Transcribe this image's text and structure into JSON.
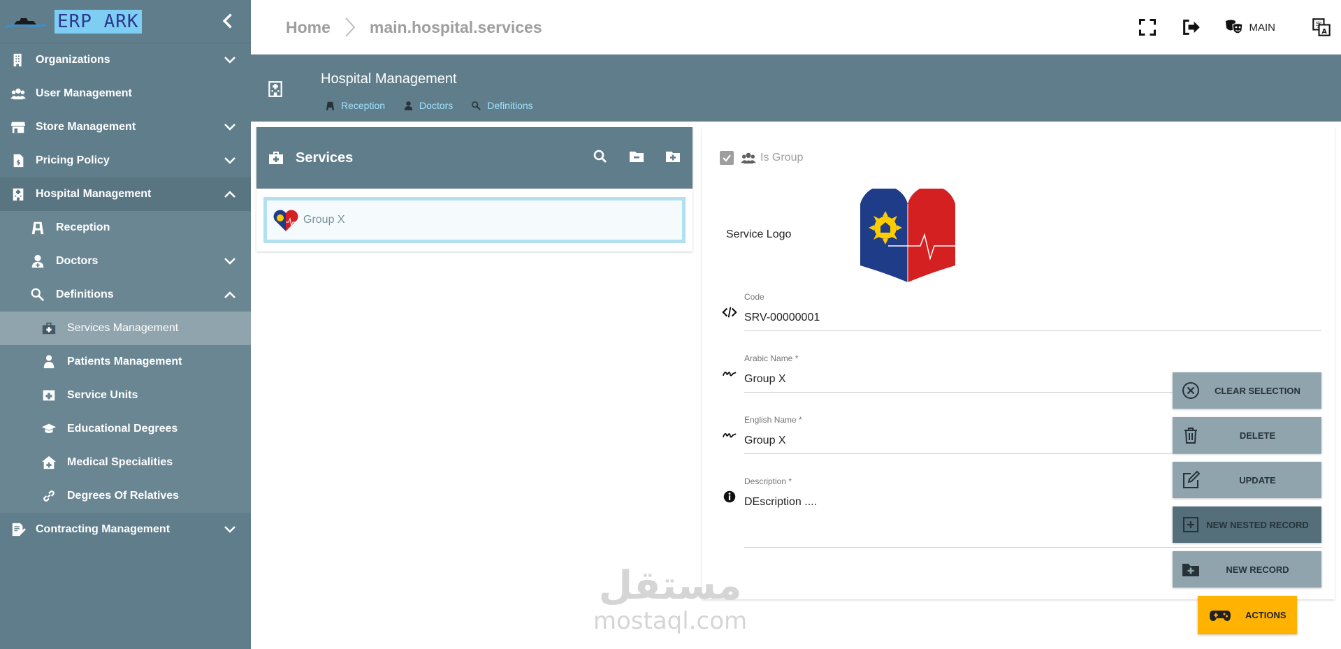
{
  "app": {
    "logo_text": "ERP ARK"
  },
  "sidebar": {
    "items": [
      {
        "label": "Organizations",
        "icon": "building-icon",
        "expand": "down"
      },
      {
        "label": "User Management",
        "icon": "users-icon"
      },
      {
        "label": "Store Management",
        "icon": "store-icon",
        "expand": "down"
      },
      {
        "label": "Pricing Policy",
        "icon": "pricing-icon",
        "expand": "down"
      },
      {
        "label": "Hospital Management",
        "icon": "hospital-icon",
        "expand": "up"
      },
      {
        "label": "Reception",
        "icon": "reception-icon"
      },
      {
        "label": "Doctors",
        "icon": "doctor-icon",
        "expand": "down"
      },
      {
        "label": "Definitions",
        "icon": "search-icon",
        "expand": "up"
      },
      {
        "label": "Services Management",
        "icon": "medkit-icon",
        "active": true
      },
      {
        "label": "Patients Management",
        "icon": "patient-icon"
      },
      {
        "label": "Service Units",
        "icon": "unit-icon"
      },
      {
        "label": "Educational Degrees",
        "icon": "graduation-icon"
      },
      {
        "label": "Medical Specialities",
        "icon": "clinic-icon"
      },
      {
        "label": "Degrees Of Relatives",
        "icon": "link-icon"
      },
      {
        "label": "Contracting Management",
        "icon": "contract-icon",
        "expand": "down"
      }
    ]
  },
  "topbar": {
    "breadcrumb_home": "Home",
    "breadcrumb_current": "main.hospital.services",
    "main_label": "MAIN"
  },
  "header": {
    "title": "Hospital Management",
    "links": [
      {
        "label": "Reception"
      },
      {
        "label": "Doctors"
      },
      {
        "label": "Definitions"
      }
    ]
  },
  "services": {
    "title": "Services",
    "rows": [
      {
        "label": "Group X"
      }
    ]
  },
  "form": {
    "is_group_label": "Is Group",
    "is_group_checked": true,
    "service_logo_label": "Service Logo",
    "code_label": "Code",
    "code_value": "SRV-00000001",
    "arabic_name_label": "Arabic Name *",
    "arabic_name_value": "Group X",
    "english_name_label": "English Name *",
    "english_name_value": "Group X",
    "description_label": "Description *",
    "description_value": "DEscription ...."
  },
  "actions": {
    "clear_selection": "CLEAR SELECTION",
    "delete": "DELETE",
    "update": "UPDATE",
    "new_nested_record": "NEW NESTED RECORD",
    "new_record": "NEW RECORD",
    "actions": "ACTIONS"
  },
  "watermark": {
    "arabic": "مستقل",
    "latin": "mostaql.com"
  },
  "colors": {
    "sidebar": "#607d8b",
    "active_item": "#90a4ae",
    "header_link": "#9ee3ff",
    "actions_button": "#ffb300"
  }
}
